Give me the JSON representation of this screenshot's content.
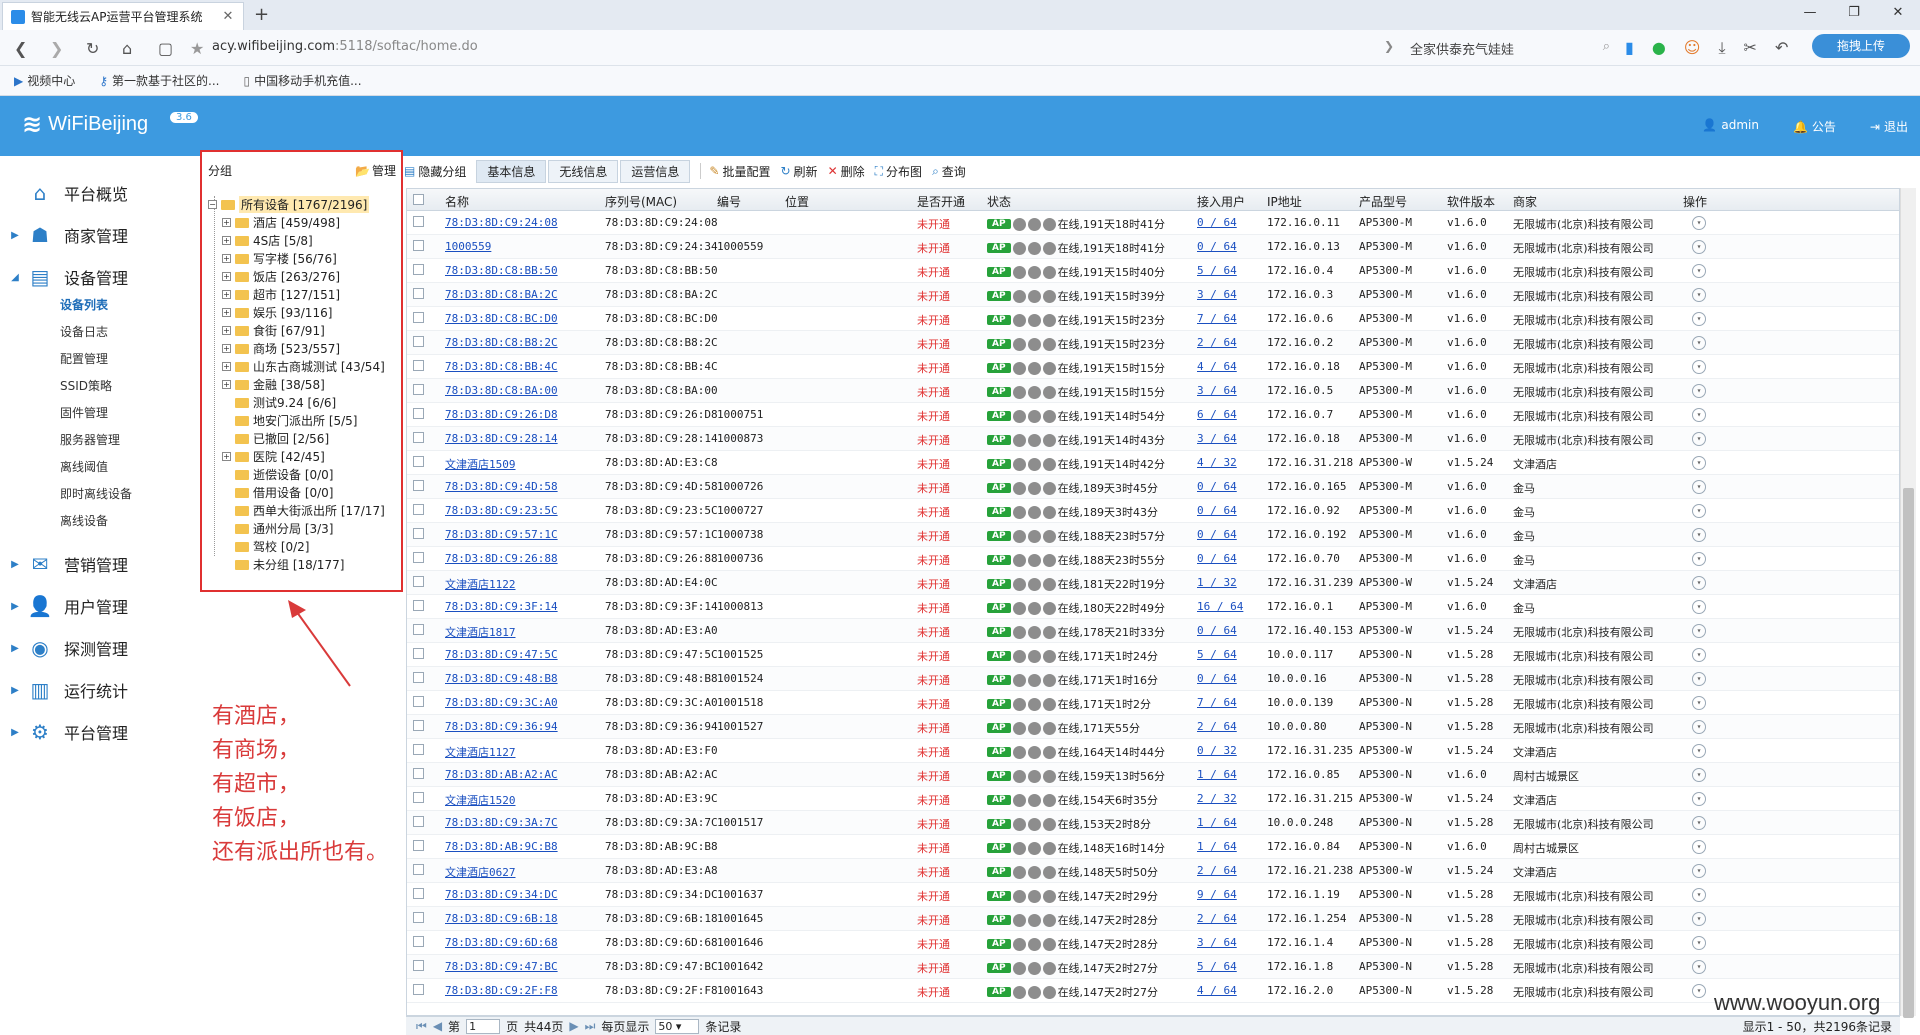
{
  "browser": {
    "tab_title": "智能无线云AP运营平台管理系统",
    "url_host": "acy.wifibeijing.com",
    "url_rest": ":5118/softac/home.do",
    "search_text": "全家供泰充气娃娃",
    "upload_label": "拖拽上传",
    "bookmarks": [
      "视频中心",
      "第一款基于社区的...",
      "中国移动手机充值..."
    ]
  },
  "header": {
    "brand": "WiFiBeijing",
    "version": "3.6",
    "user": "admin",
    "notice": "公告",
    "logout": "退出"
  },
  "nav": {
    "items": [
      {
        "label": "平台概览",
        "icon": "home-icon"
      },
      {
        "label": "商家管理",
        "icon": "merchant-icon"
      },
      {
        "label": "设备管理",
        "icon": "device-icon"
      },
      {
        "label": "营销管理",
        "icon": "marketing-icon"
      },
      {
        "label": "用户管理",
        "icon": "user-icon"
      },
      {
        "label": "探测管理",
        "icon": "probe-icon"
      },
      {
        "label": "运行统计",
        "icon": "stats-icon"
      },
      {
        "label": "平台管理",
        "icon": "gear-icon"
      }
    ],
    "sub_items": [
      "设备列表",
      "设备日志",
      "配置管理",
      "SSID策略",
      "固件管理",
      "服务器管理",
      "离线阈值",
      "即时离线设备",
      "离线设备"
    ]
  },
  "groups": {
    "title": "分组",
    "manage": "管理",
    "root": "所有设备 [1767/2196]",
    "items": [
      {
        "label": "酒店 [459/498]",
        "expand": true
      },
      {
        "label": "4S店 [5/8]",
        "expand": true
      },
      {
        "label": "写字楼 [56/76]",
        "expand": true
      },
      {
        "label": "饭店 [263/276]",
        "expand": true
      },
      {
        "label": "超市 [127/151]",
        "expand": true
      },
      {
        "label": "娱乐 [93/116]",
        "expand": true
      },
      {
        "label": "食街 [67/91]",
        "expand": true
      },
      {
        "label": "商场 [523/557]",
        "expand": true
      },
      {
        "label": "山东古商城测试 [43/54]",
        "expand": true
      },
      {
        "label": "金融 [38/58]",
        "expand": true
      },
      {
        "label": "测试9.24 [6/6]",
        "expand": false
      },
      {
        "label": "地安门派出所 [5/5]",
        "expand": false
      },
      {
        "label": "已撤回 [2/56]",
        "expand": false
      },
      {
        "label": "医院 [42/45]",
        "expand": true
      },
      {
        "label": "逝偿设备 [0/0]",
        "expand": false
      },
      {
        "label": "借用设备 [0/0]",
        "expand": false
      },
      {
        "label": "西单大街派出所 [17/17]",
        "expand": false
      },
      {
        "label": "通州分局 [3/3]",
        "expand": false
      },
      {
        "label": "驾校 [0/2]",
        "expand": false
      },
      {
        "label": "未分组 [18/177]",
        "expand": false
      }
    ]
  },
  "annotation": [
    "有酒店，",
    "有商场，",
    "有超市，",
    "有饭店，",
    "还有派出所也有。"
  ],
  "toolbar": {
    "hide_group": "隐藏分组",
    "tabs": [
      "基本信息",
      "无线信息",
      "运营信息"
    ],
    "batch": "批量配置",
    "refresh": "刷新",
    "delete": "删除",
    "map": "分布图",
    "query": "查询"
  },
  "table": {
    "headers": [
      "名称",
      "序列号(MAC)",
      "编号",
      "位置",
      "是否开通",
      "状态",
      "接入用户",
      "IP地址",
      "产品型号",
      "软件版本",
      "商家",
      "操作"
    ],
    "rows": [
      [
        "78:D3:8D:C9:24:08",
        "78:D3:8D:C9:24:08",
        "",
        "未开通",
        "在线,191天18时41分",
        "0 / 64",
        "172.16.0.11",
        "AP5300-M",
        "v1.6.0",
        "无限城市(北京)科技有限公司"
      ],
      [
        "1000559",
        "78:D3:8D:C9:24:34",
        "1000559",
        "未开通",
        "在线,191天18时41分",
        "0 / 64",
        "172.16.0.13",
        "AP5300-M",
        "v1.6.0",
        "无限城市(北京)科技有限公司"
      ],
      [
        "78:D3:8D:C8:BB:50",
        "78:D3:8D:C8:BB:50",
        "",
        "未开通",
        "在线,191天15时40分",
        "5 / 64",
        "172.16.0.4",
        "AP5300-M",
        "v1.6.0",
        "无限城市(北京)科技有限公司"
      ],
      [
        "78:D3:8D:C8:BA:2C",
        "78:D3:8D:C8:BA:2C",
        "",
        "未开通",
        "在线,191天15时39分",
        "3 / 64",
        "172.16.0.3",
        "AP5300-M",
        "v1.6.0",
        "无限城市(北京)科技有限公司"
      ],
      [
        "78:D3:8D:C8:BC:D0",
        "78:D3:8D:C8:BC:D0",
        "",
        "未开通",
        "在线,191天15时23分",
        "7 / 64",
        "172.16.0.6",
        "AP5300-M",
        "v1.6.0",
        "无限城市(北京)科技有限公司"
      ],
      [
        "78:D3:8D:C8:B8:2C",
        "78:D3:8D:C8:B8:2C",
        "",
        "未开通",
        "在线,191天15时23分",
        "2 / 64",
        "172.16.0.2",
        "AP5300-M",
        "v1.6.0",
        "无限城市(北京)科技有限公司"
      ],
      [
        "78:D3:8D:C8:BB:4C",
        "78:D3:8D:C8:BB:4C",
        "",
        "未开通",
        "在线,191天15时15分",
        "4 / 64",
        "172.16.0.18",
        "AP5300-M",
        "v1.6.0",
        "无限城市(北京)科技有限公司"
      ],
      [
        "78:D3:8D:C8:BA:00",
        "78:D3:8D:C8:BA:00",
        "",
        "未开通",
        "在线,191天15时15分",
        "3 / 64",
        "172.16.0.5",
        "AP5300-M",
        "v1.6.0",
        "无限城市(北京)科技有限公司"
      ],
      [
        "78:D3:8D:C9:26:D8",
        "78:D3:8D:C9:26:D8",
        "1000751",
        "未开通",
        "在线,191天14时54分",
        "6 / 64",
        "172.16.0.7",
        "AP5300-M",
        "v1.6.0",
        "无限城市(北京)科技有限公司"
      ],
      [
        "78:D3:8D:C9:28:14",
        "78:D3:8D:C9:28:14",
        "1000873",
        "未开通",
        "在线,191天14时43分",
        "3 / 64",
        "172.16.0.18",
        "AP5300-M",
        "v1.6.0",
        "无限城市(北京)科技有限公司"
      ],
      [
        "文津酒店1509",
        "78:D3:8D:AD:E3:C8",
        "",
        "未开通",
        "在线,191天14时42分",
        "4 / 32",
        "172.16.31.218",
        "AP5300-W",
        "v1.5.24",
        "文津酒店"
      ],
      [
        "78:D3:8D:C9:4D:58",
        "78:D3:8D:C9:4D:58",
        "1000726",
        "未开通",
        "在线,189天3时45分",
        "0 / 64",
        "172.16.0.165",
        "AP5300-M",
        "v1.6.0",
        "金马"
      ],
      [
        "78:D3:8D:C9:23:5C",
        "78:D3:8D:C9:23:5C",
        "1000727",
        "未开通",
        "在线,189天3时43分",
        "0 / 64",
        "172.16.0.92",
        "AP5300-M",
        "v1.6.0",
        "金马"
      ],
      [
        "78:D3:8D:C9:57:1C",
        "78:D3:8D:C9:57:1C",
        "1000738",
        "未开通",
        "在线,188天23时57分",
        "0 / 64",
        "172.16.0.192",
        "AP5300-M",
        "v1.6.0",
        "金马"
      ],
      [
        "78:D3:8D:C9:26:88",
        "78:D3:8D:C9:26:88",
        "1000736",
        "未开通",
        "在线,188天23时55分",
        "0 / 64",
        "172.16.0.70",
        "AP5300-M",
        "v1.6.0",
        "金马"
      ],
      [
        "文津酒店1122",
        "78:D3:8D:AD:E4:0C",
        "",
        "未开通",
        "在线,181天22时19分",
        "1 / 32",
        "172.16.31.239",
        "AP5300-W",
        "v1.5.24",
        "文津酒店"
      ],
      [
        "78:D3:8D:C9:3F:14",
        "78:D3:8D:C9:3F:14",
        "1000813",
        "未开通",
        "在线,180天22时49分",
        "16 / 64",
        "172.16.0.1",
        "AP5300-M",
        "v1.6.0",
        "金马"
      ],
      [
        "文津酒店1817",
        "78:D3:8D:AD:E3:A0",
        "",
        "未开通",
        "在线,178天21时33分",
        "0 / 64",
        "172.16.40.153",
        "AP5300-W",
        "v1.5.24",
        "无限城市(北京)科技有限公司"
      ],
      [
        "78:D3:8D:C9:47:5C",
        "78:D3:8D:C9:47:5C",
        "1001525",
        "未开通",
        "在线,171天1时24分",
        "5 / 64",
        "10.0.0.117",
        "AP5300-N",
        "v1.5.28",
        "无限城市(北京)科技有限公司"
      ],
      [
        "78:D3:8D:C9:48:B8",
        "78:D3:8D:C9:48:B8",
        "1001524",
        "未开通",
        "在线,171天1时16分",
        "0 / 64",
        "10.0.0.16",
        "AP5300-N",
        "v1.5.28",
        "无限城市(北京)科技有限公司"
      ],
      [
        "78:D3:8D:C9:3C:A0",
        "78:D3:8D:C9:3C:A0",
        "1001518",
        "未开通",
        "在线,171天1时2分",
        "7 / 64",
        "10.0.0.139",
        "AP5300-N",
        "v1.5.28",
        "无限城市(北京)科技有限公司"
      ],
      [
        "78:D3:8D:C9:36:94",
        "78:D3:8D:C9:36:94",
        "1001527",
        "未开通",
        "在线,171天55分",
        "2 / 64",
        "10.0.0.80",
        "AP5300-N",
        "v1.5.28",
        "无限城市(北京)科技有限公司"
      ],
      [
        "文津酒店1127",
        "78:D3:8D:AD:E3:F0",
        "",
        "未开通",
        "在线,164天14时44分",
        "0 / 32",
        "172.16.31.235",
        "AP5300-W",
        "v1.5.24",
        "文津酒店"
      ],
      [
        "78:D3:8D:AB:A2:AC",
        "78:D3:8D:AB:A2:AC",
        "",
        "未开通",
        "在线,159天13时56分",
        "1 / 64",
        "172.16.0.85",
        "AP5300-N",
        "v1.6.0",
        "周村古城景区"
      ],
      [
        "文津酒店1520",
        "78:D3:8D:AD:E3:9C",
        "",
        "未开通",
        "在线,154天6时35分",
        "2 / 32",
        "172.16.31.215",
        "AP5300-W",
        "v1.5.24",
        "文津酒店"
      ],
      [
        "78:D3:8D:C9:3A:7C",
        "78:D3:8D:C9:3A:7C",
        "1001517",
        "未开通",
        "在线,153天2时8分",
        "1 / 64",
        "10.0.0.248",
        "AP5300-N",
        "v1.5.28",
        "无限城市(北京)科技有限公司"
      ],
      [
        "78:D3:8D:AB:9C:B8",
        "78:D3:8D:AB:9C:B8",
        "",
        "未开通",
        "在线,148天16时14分",
        "1 / 64",
        "172.16.0.84",
        "AP5300-N",
        "v1.6.0",
        "周村古城景区"
      ],
      [
        "文津酒店0627",
        "78:D3:8D:AD:E3:A8",
        "",
        "未开通",
        "在线,148天5时50分",
        "2 / 64",
        "172.16.21.238",
        "AP5300-W",
        "v1.5.24",
        "文津酒店"
      ],
      [
        "78:D3:8D:C9:34:DC",
        "78:D3:8D:C9:34:DC",
        "1001637",
        "未开通",
        "在线,147天2时29分",
        "9 / 64",
        "172.16.1.19",
        "AP5300-N",
        "v1.5.28",
        "无限城市(北京)科技有限公司"
      ],
      [
        "78:D3:8D:C9:6B:18",
        "78:D3:8D:C9:6B:18",
        "1001645",
        "未开通",
        "在线,147天2时28分",
        "2 / 64",
        "172.16.1.254",
        "AP5300-N",
        "v1.5.28",
        "无限城市(北京)科技有限公司"
      ],
      [
        "78:D3:8D:C9:6D:68",
        "78:D3:8D:C9:6D:68",
        "1001646",
        "未开通",
        "在线,147天2时28分",
        "3 / 64",
        "172.16.1.4",
        "AP5300-N",
        "v1.5.28",
        "无限城市(北京)科技有限公司"
      ],
      [
        "78:D3:8D:C9:47:BC",
        "78:D3:8D:C9:47:BC",
        "1001642",
        "未开通",
        "在线,147天2时27分",
        "5 / 64",
        "172.16.1.8",
        "AP5300-N",
        "v1.5.28",
        "无限城市(北京)科技有限公司"
      ],
      [
        "78:D3:8D:C9:2F:F8",
        "78:D3:8D:C9:2F:F8",
        "1001643",
        "未开通",
        "在线,147天2时27分",
        "4 / 64",
        "172.16.2.0",
        "AP5300-N",
        "v1.5.28",
        "无限城市(北京)科技有限公司"
      ]
    ]
  },
  "pager": {
    "page_prefix": "第",
    "page_value": "1",
    "page_suffix": "页",
    "total_pages": "共44页",
    "per_page_prefix": "每页显示",
    "per_page_value": "50",
    "per_page_suffix": "条记录",
    "info": "显示1 - 50，共2196条记录"
  },
  "watermark": "www.wooyun.org"
}
